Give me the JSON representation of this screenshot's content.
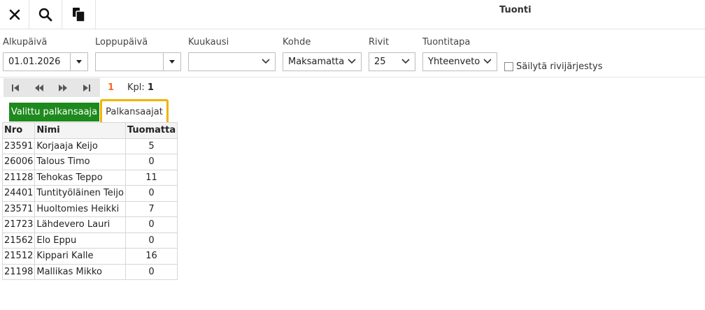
{
  "toolbar": {
    "title": "Tuonti",
    "icons": [
      "close-icon",
      "search-icon",
      "copy-icon"
    ]
  },
  "filters": {
    "start_date": {
      "label": "Alkupäivä",
      "value": "01.01.2026"
    },
    "end_date": {
      "label": "Loppupäivä",
      "value": ""
    },
    "month": {
      "label": "Kuukausi",
      "value": ""
    },
    "target": {
      "label": "Kohde",
      "value": "Maksamatta"
    },
    "rows": {
      "label": "Rivit",
      "value": "25"
    },
    "import_mode": {
      "label": "Tuontitapa",
      "value": "Yhteenveto"
    },
    "keep_order": {
      "label": "Säilytä rivijärjestys",
      "checked": false
    }
  },
  "pager": {
    "page": "1",
    "count_label": "Kpl:",
    "count_value": "1"
  },
  "tabs": {
    "selected_label": "Valittu palkansaaja",
    "other_label": "Palkansaajat"
  },
  "table": {
    "headers": [
      "Nro",
      "Nimi",
      "Tuomatta"
    ],
    "rows": [
      [
        "23591",
        "Korjaaja Keijo",
        "5"
      ],
      [
        "26006",
        "Talous Timo",
        "0"
      ],
      [
        "21128",
        "Tehokas Teppo",
        "11"
      ],
      [
        "24401",
        "Tuntityöläinen Teijo",
        "0"
      ],
      [
        "23571",
        "Huoltomies Heikki",
        "7"
      ],
      [
        "21723",
        "Lähdevero Lauri",
        "0"
      ],
      [
        "21562",
        "Elo Eppu",
        "0"
      ],
      [
        "21512",
        "Kippari Kalle",
        "16"
      ],
      [
        "21198",
        "Mallikas Mikko",
        "0"
      ]
    ]
  },
  "colors": {
    "accent_green": "#1e8a1e",
    "highlight_orange": "#f0b400",
    "page_number": "#f26b21"
  }
}
